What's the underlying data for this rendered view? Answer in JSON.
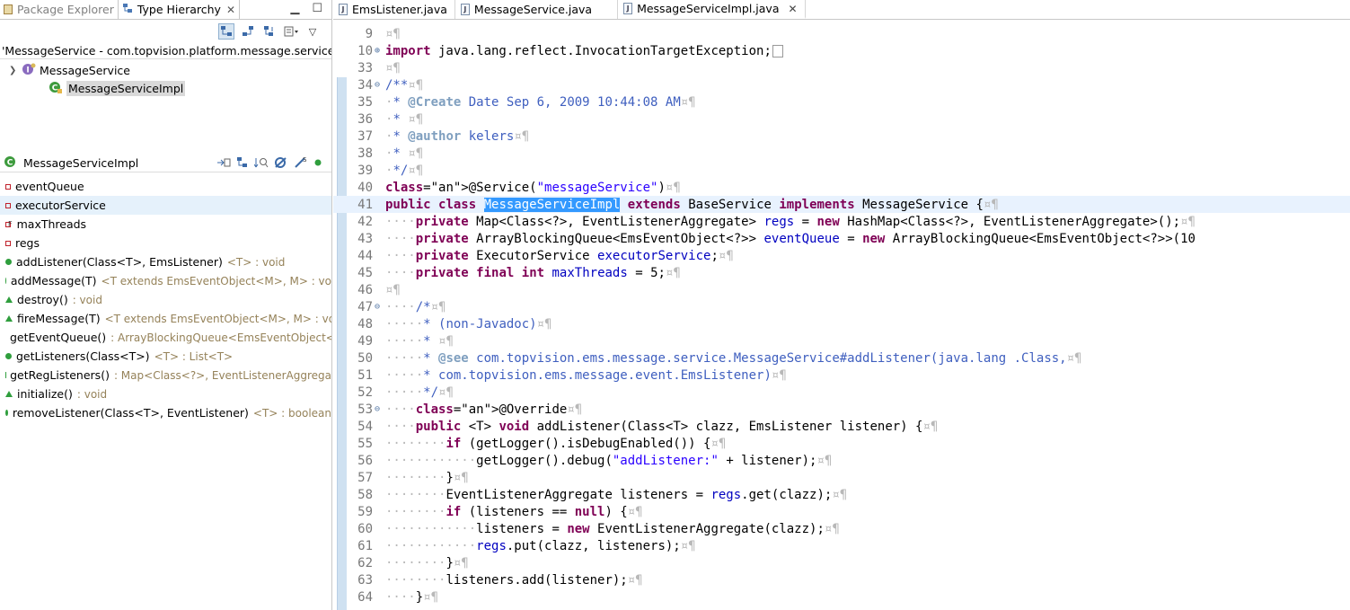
{
  "left_panel": {
    "tabs": [
      {
        "label": "Package Explorer",
        "active": false
      },
      {
        "label": "Type Hierarchy",
        "active": true
      }
    ],
    "hierarchy_title": "'MessageService - com.topvision.platform.message.service' - in",
    "tree": [
      {
        "label": "MessageService",
        "kind": "interface"
      },
      {
        "label": "MessageServiceImpl",
        "kind": "class"
      }
    ],
    "members_title": "MessageServiceImpl",
    "members": [
      {
        "name": "eventQueue",
        "type": "",
        "kind": "field"
      },
      {
        "name": "executorService",
        "type": "",
        "kind": "field"
      },
      {
        "name": "maxThreads",
        "type": "",
        "kind": "final-field"
      },
      {
        "name": "regs",
        "type": "",
        "kind": "field"
      },
      {
        "name": "addListener(Class<T>, EmsListener)",
        "type": "<T> : void",
        "kind": "method"
      },
      {
        "name": "addMessage(T)",
        "type": "<T extends EmsEventObject<M>, M> : vo",
        "kind": "method"
      },
      {
        "name": "destroy()",
        "type": ": void",
        "kind": "method-protected"
      },
      {
        "name": "fireMessage(T)",
        "type": "<T extends EmsEventObject<M>, M> : vo",
        "kind": "method-protected"
      },
      {
        "name": "getEventQueue()",
        "type": ": ArrayBlockingQueue<EmsEventObject<",
        "kind": "method"
      },
      {
        "name": "getListeners(Class<T>)",
        "type": "<T> : List<T>",
        "kind": "method"
      },
      {
        "name": "getRegListeners()",
        "type": ": Map<Class<?>, EventListenerAggrega",
        "kind": "method"
      },
      {
        "name": "initialize()",
        "type": ": void",
        "kind": "method-protected"
      },
      {
        "name": "removeListener(Class<T>, EventListener)",
        "type": "<T> : boolean",
        "kind": "method"
      }
    ]
  },
  "editor": {
    "tabs": [
      {
        "label": "EmsListener.java",
        "active": false
      },
      {
        "label": "MessageService.java",
        "active": false
      },
      {
        "label": "MessageServiceImpl.java",
        "active": true
      }
    ],
    "lines": [
      {
        "n": "9",
        "fold": "",
        "text": "¤¶"
      },
      {
        "n": "10",
        "fold": "⊕",
        "text": "import java.lang.reflect.InvocationTargetException;"
      },
      {
        "n": "33",
        "fold": "",
        "text": "¤¶"
      },
      {
        "n": "34",
        "fold": "⊖",
        "text": "/**¤¶"
      },
      {
        "n": "35",
        "fold": "",
        "text": " * @Create Date Sep 6, 2009 10:44:08 AM¤¶"
      },
      {
        "n": "36",
        "fold": "",
        "text": " * ¤¶"
      },
      {
        "n": "37",
        "fold": "",
        "text": " * @author kelers¤¶"
      },
      {
        "n": "38",
        "fold": "",
        "text": " * ¤¶"
      },
      {
        "n": "39",
        "fold": "",
        "text": " */¤¶"
      },
      {
        "n": "40",
        "fold": "",
        "text": "@Service(\"messageService\")¤¶"
      },
      {
        "n": "41",
        "fold": "",
        "text": "public class MessageServiceImpl extends BaseService implements MessageService {¤¶"
      },
      {
        "n": "42",
        "fold": "",
        "text": "    private Map<Class<?>, EventListenerAggregate> regs = new HashMap<Class<?>, EventListenerAggregate>();¤¶"
      },
      {
        "n": "43",
        "fold": "",
        "text": "    private ArrayBlockingQueue<EmsEventObject<?>> eventQueue = new ArrayBlockingQueue<EmsEventObject<?>>(10"
      },
      {
        "n": "44",
        "fold": "",
        "text": "    private ExecutorService executorService;¤¶"
      },
      {
        "n": "45",
        "fold": "",
        "text": "    private final int maxThreads = 5;¤¶"
      },
      {
        "n": "46",
        "fold": "",
        "text": "¤¶"
      },
      {
        "n": "47",
        "fold": "⊖",
        "text": "    /*¤¶"
      },
      {
        "n": "48",
        "fold": "",
        "text": "     * (non-Javadoc)¤¶"
      },
      {
        "n": "49",
        "fold": "",
        "text": "     * ¤¶"
      },
      {
        "n": "50",
        "fold": "",
        "text": "     * @see com.topvision.ems.message.service.MessageService#addListener(java.lang .Class,¤¶"
      },
      {
        "n": "51",
        "fold": "",
        "text": "     * com.topvision.ems.message.event.EmsListener)¤¶"
      },
      {
        "n": "52",
        "fold": "",
        "text": "     */¤¶"
      },
      {
        "n": "53",
        "fold": "⊖",
        "text": "    @Override¤¶"
      },
      {
        "n": "54",
        "fold": "",
        "text": "    public <T> void addListener(Class<T> clazz, EmsListener listener) {¤¶"
      },
      {
        "n": "55",
        "fold": "",
        "text": "        if (getLogger().isDebugEnabled()) {¤¶"
      },
      {
        "n": "56",
        "fold": "",
        "text": "            getLogger().debug(\"addListener:\" + listener);¤¶"
      },
      {
        "n": "57",
        "fold": "",
        "text": "        }¤¶"
      },
      {
        "n": "58",
        "fold": "",
        "text": "        EventListenerAggregate listeners = regs.get(clazz);¤¶"
      },
      {
        "n": "59",
        "fold": "",
        "text": "        if (listeners == null) {¤¶"
      },
      {
        "n": "60",
        "fold": "",
        "text": "            listeners = new EventListenerAggregate(clazz);¤¶"
      },
      {
        "n": "61",
        "fold": "",
        "text": "            regs.put(clazz, listeners);¤¶"
      },
      {
        "n": "62",
        "fold": "",
        "text": "        }¤¶"
      },
      {
        "n": "63",
        "fold": "",
        "text": "        listeners.add(listener);¤¶"
      },
      {
        "n": "64",
        "fold": "",
        "text": "    }¤¶"
      }
    ],
    "current_line": "41",
    "selected_word": "MessageServiceImpl"
  },
  "colors": {
    "keyword": "#7f0055",
    "javadoc": "#3f5fbf",
    "string": "#2a00ff",
    "field": "#0000c0",
    "annotation": "#646464",
    "selection": "#3399ff",
    "current_line": "#e8f2fe"
  }
}
